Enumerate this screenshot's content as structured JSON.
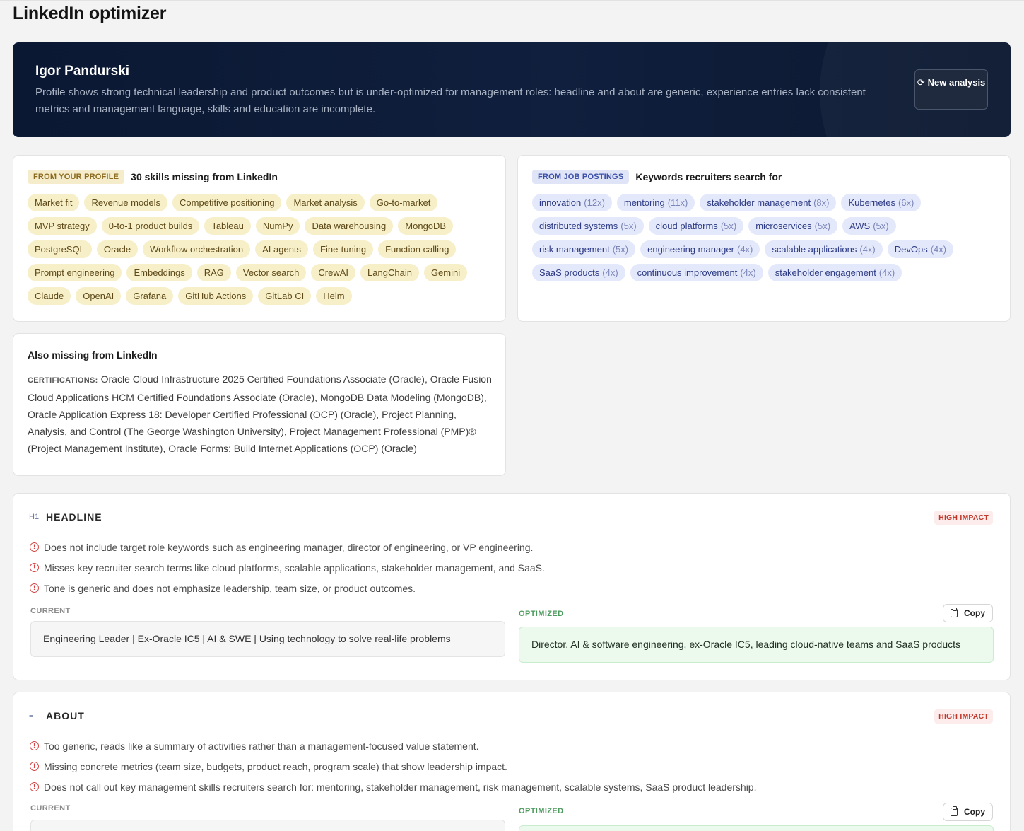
{
  "page": {
    "title": "LinkedIn optimizer"
  },
  "hero": {
    "name": "Igor Pandurski",
    "summary": "Profile shows strong technical leadership and product outcomes but is under-optimized for management roles: headline and about are generic, experience entries lack consistent metrics and management language, skills and education are incomplete.",
    "new_analysis_label": "New analysis",
    "new_analysis_icon": "refresh-icon"
  },
  "skills_card": {
    "badge": "FROM YOUR PROFILE",
    "title": "30 skills missing from LinkedIn",
    "skills": [
      "Market fit",
      "Revenue models",
      "Competitive positioning",
      "Market analysis",
      "Go-to-market",
      "MVP strategy",
      "0-to-1 product builds",
      "Tableau",
      "NumPy",
      "Data warehousing",
      "MongoDB",
      "PostgreSQL",
      "Oracle",
      "Workflow orchestration",
      "AI agents",
      "Fine-tuning",
      "Function calling",
      "Prompt engineering",
      "Embeddings",
      "RAG",
      "Vector search",
      "CrewAI",
      "LangChain",
      "Gemini",
      "Claude",
      "OpenAI",
      "Grafana",
      "GitHub Actions",
      "GitLab CI",
      "Helm"
    ]
  },
  "keywords_card": {
    "badge": "FROM JOB POSTINGS",
    "title": "Keywords recruiters search for",
    "keywords": [
      {
        "term": "innovation",
        "count": "(12x)"
      },
      {
        "term": "mentoring",
        "count": "(11x)"
      },
      {
        "term": "stakeholder management",
        "count": "(8x)"
      },
      {
        "term": "Kubernetes",
        "count": "(6x)"
      },
      {
        "term": "distributed systems",
        "count": "(5x)"
      },
      {
        "term": "cloud platforms",
        "count": "(5x)"
      },
      {
        "term": "microservices",
        "count": "(5x)"
      },
      {
        "term": "AWS",
        "count": "(5x)"
      },
      {
        "term": "risk management",
        "count": "(5x)"
      },
      {
        "term": "engineering manager",
        "count": "(4x)"
      },
      {
        "term": "scalable applications",
        "count": "(4x)"
      },
      {
        "term": "DevOps",
        "count": "(4x)"
      },
      {
        "term": "SaaS products",
        "count": "(4x)"
      },
      {
        "term": "continuous improvement",
        "count": "(4x)"
      },
      {
        "term": "stakeholder engagement",
        "count": "(4x)"
      }
    ]
  },
  "also_missing": {
    "title": "Also missing from LinkedIn",
    "cert_label": "CERTIFICATIONS:",
    "cert_text": "Oracle Cloud Infrastructure 2025 Certified Foundations Associate (Oracle), Oracle Fusion Cloud Applications HCM Certified Foundations Associate (Oracle), MongoDB Data Modeling (MongoDB), Oracle Application Express 18: Developer Certified Professional (OCP) (Oracle), Project Planning, Analysis, and Control (The George Washington University), Project Management Professional (PMP)® (Project Management Institute), Oracle Forms: Build Internet Applications (OCP) (Oracle)"
  },
  "headline_section": {
    "icon_text": "H1",
    "title": "HEADLINE",
    "impact": "HIGH IMPACT",
    "issues": [
      "Does not include target role keywords such as engineering manager, director of engineering, or VP engineering.",
      "Misses key recruiter search terms like cloud platforms, scalable applications, stakeholder management, and SaaS.",
      "Tone is generic and does not emphasize leadership, team size, or product outcomes."
    ],
    "current_label": "CURRENT",
    "current_text": "Engineering Leader | Ex-Oracle IC5 | AI & SWE | Using technology to solve real-life problems",
    "optimized_label": "OPTIMIZED",
    "optimized_text": "Director, AI & software engineering, ex-Oracle IC5, leading cloud-native teams and SaaS products",
    "copy_label": "Copy"
  },
  "about_section": {
    "title": "ABOUT",
    "impact": "HIGH IMPACT",
    "issues": [
      "Too generic, reads like a summary of activities rather than a management-focused value statement.",
      "Missing concrete metrics (team size, budgets, product reach, program scale) that show leadership impact.",
      "Does not call out key management skills recruiters search for: mentoring, stakeholder management, risk management, scalable systems, SaaS product leadership."
    ],
    "current_label": "CURRENT",
    "optimized_label": "OPTIMIZED",
    "copy_label": "Copy"
  }
}
